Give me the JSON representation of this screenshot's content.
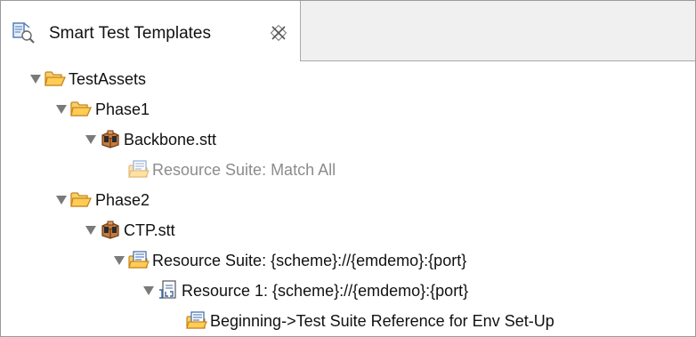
{
  "tab": {
    "title": "Smart Test Templates",
    "icon": "test-templates-icon",
    "close_icon": "close-x-icon"
  },
  "tree": {
    "root": {
      "label": "TestAssets",
      "icon": "open-folder-icon",
      "expanded": true
    },
    "phase1": {
      "label": "Phase1",
      "icon": "open-folder-icon",
      "expanded": true
    },
    "backbone": {
      "label": "Backbone.stt",
      "icon": "template-package-icon",
      "expanded": true
    },
    "backbone_suite": {
      "label": "Resource Suite: Match All",
      "icon": "resource-suite-icon",
      "muted": true
    },
    "phase2": {
      "label": "Phase2",
      "icon": "open-folder-icon",
      "expanded": true
    },
    "ctp": {
      "label": "CTP.stt",
      "icon": "template-package-icon",
      "expanded": true
    },
    "ctp_suite": {
      "label": "Resource Suite: {scheme}://{emdemo}:{port}",
      "icon": "resource-suite-icon",
      "expanded": true
    },
    "resource1": {
      "label": "Resource 1: {scheme}://{emdemo}:{port}",
      "icon": "resource-file-icon",
      "expanded": true
    },
    "beginning": {
      "label": "Beginning->Test Suite Reference for Env Set-Up",
      "icon": "resource-suite-icon"
    }
  },
  "colors": {
    "folder": "#f3b23a",
    "package": "#9a5b2b",
    "suite_blue": "#3b67a8",
    "muted_text": "#8c8c8c"
  }
}
